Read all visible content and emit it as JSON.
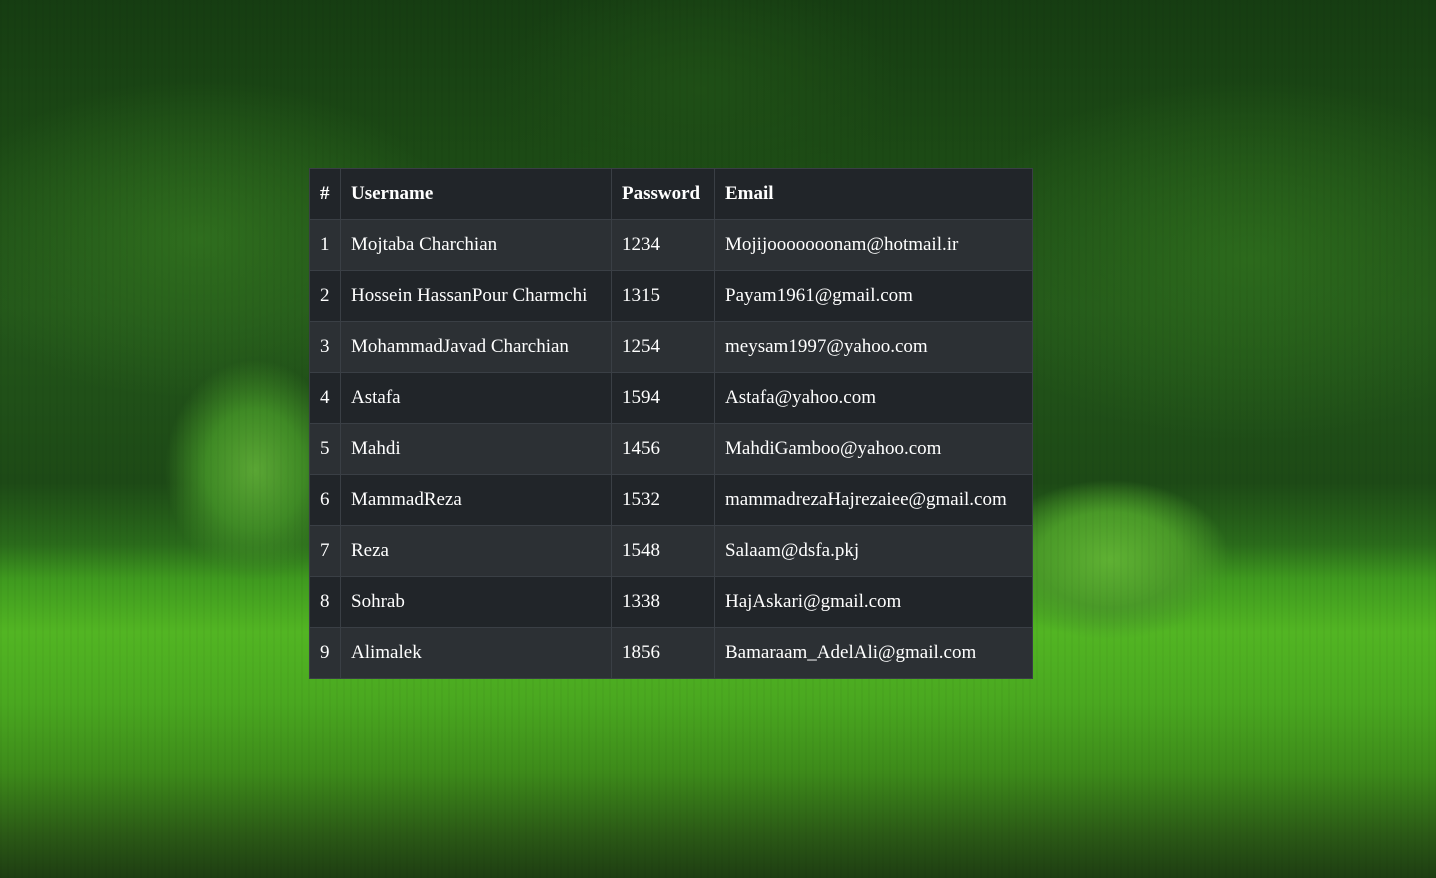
{
  "table": {
    "headers": [
      "#",
      "Username",
      "Password",
      "Email"
    ],
    "rows": [
      {
        "num": "1",
        "username": "Mojtaba Charchian",
        "password": "1234",
        "email": "Mojijooooooonam@hotmail.ir"
      },
      {
        "num": "2",
        "username": "Hossein HassanPour Charmchi",
        "password": "1315",
        "email": "Payam1961@gmail.com"
      },
      {
        "num": "3",
        "username": "MohammadJavad Charchian",
        "password": "1254",
        "email": "meysam1997@yahoo.com"
      },
      {
        "num": "4",
        "username": "Astafa",
        "password": "1594",
        "email": "Astafa@yahoo.com"
      },
      {
        "num": "5",
        "username": "Mahdi",
        "password": "1456",
        "email": "MahdiGamboo@yahoo.com"
      },
      {
        "num": "6",
        "username": "MammadReza",
        "password": "1532",
        "email": "mammadrezaHajrezaiee@gmail.com"
      },
      {
        "num": "7",
        "username": "Reza",
        "password": "1548",
        "email": "Salaam@dsfa.pkj"
      },
      {
        "num": "8",
        "username": "Sohrab",
        "password": "1338",
        "email": "HajAskari@gmail.com"
      },
      {
        "num": "9",
        "username": "Alimalek",
        "password": "1856",
        "email": "Bamaraam_AdelAli@gmail.com"
      }
    ]
  },
  "colors": {
    "header_bg": "#212529",
    "row_odd_bg": "#2c3034",
    "row_even_bg": "#212529",
    "text": "#ffffff",
    "border": "#3a3f45"
  }
}
